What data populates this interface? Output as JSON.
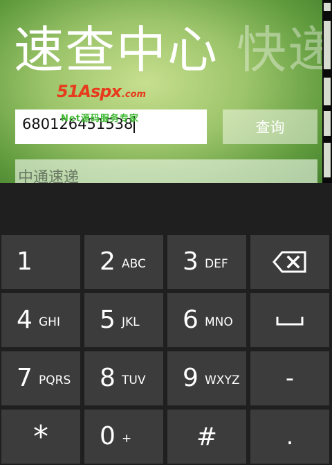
{
  "app": {
    "title_main": "速查中心",
    "title_next": "快递",
    "phone_input": {
      "value": "680126451538"
    },
    "query_button": "查询",
    "company_select": {
      "value": "中通速递"
    }
  },
  "watermark": {
    "logo": "51Aspx",
    "logo_suffix": ".com",
    "subtitle": "Net源码服务专家"
  },
  "keyboard": {
    "keys": [
      {
        "main": "1",
        "sub": ""
      },
      {
        "main": "2",
        "sub": "ABC"
      },
      {
        "main": "3",
        "sub": "DEF"
      },
      {
        "main": "4",
        "sub": "GHI"
      },
      {
        "main": "5",
        "sub": "JKL"
      },
      {
        "main": "6",
        "sub": "MNO"
      },
      {
        "main": "7",
        "sub": "PQRS"
      },
      {
        "main": "8",
        "sub": "TUV"
      },
      {
        "main": "9",
        "sub": "WXYZ"
      },
      {
        "main": "*",
        "sub": ""
      },
      {
        "main": "0",
        "sub": "+"
      },
      {
        "main": "#",
        "sub": ""
      }
    ],
    "backspace_icon": "backspace-icon",
    "space_icon": "space-icon",
    "dash": "-",
    "dot": "."
  }
}
